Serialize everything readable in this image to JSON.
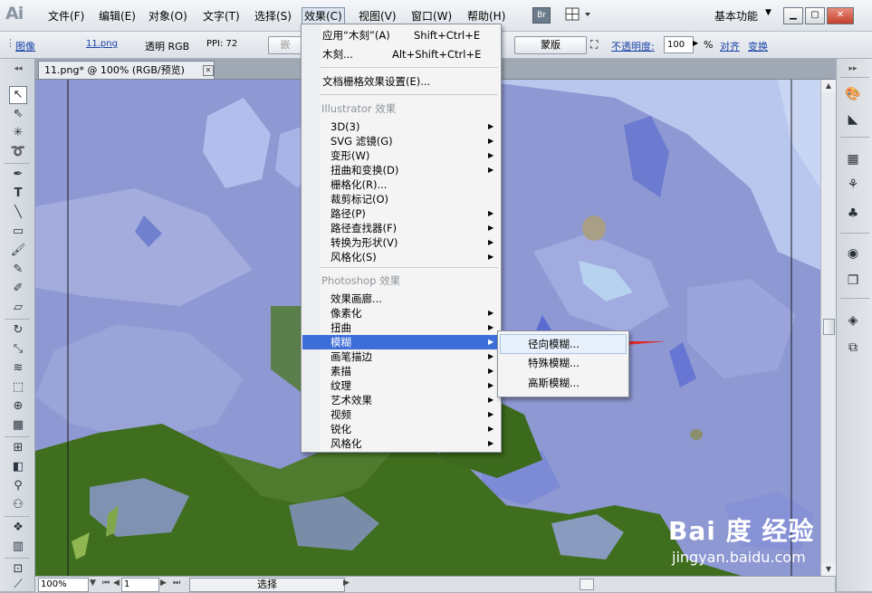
{
  "app": {
    "logo": "Ai"
  },
  "menubar": {
    "items": [
      "文件(F)",
      "编辑(E)",
      "对象(O)",
      "文字(T)",
      "选择(S)",
      "效果(C)",
      "视图(V)",
      "窗口(W)",
      "帮助(H)"
    ],
    "bridge_label": "Br",
    "workspace": "基本功能"
  },
  "controlbar": {
    "object_type": "图像",
    "file_link": "11.png",
    "color_mode": "透明 RGB",
    "ppi": "PPI: 72",
    "embed_button": "嵌",
    "mask_button": "蒙版",
    "opacity_label": "不透明度:",
    "opacity_value": "100",
    "opacity_unit": "%",
    "align_link": "对齐",
    "transform_link": "变换"
  },
  "document": {
    "tab_title": "11.png* @ 100% (RGB/预览)",
    "close_glyph": "✕"
  },
  "effect_menu": {
    "top_items": [
      {
        "label": "应用“木刻”(A)",
        "shortcut": "Shift+Ctrl+E"
      },
      {
        "label": "木刻...",
        "shortcut": "Alt+Shift+Ctrl+E"
      }
    ],
    "raster_settings": "文档栅格效果设置(E)...",
    "illustrator_header": "Illustrator 效果",
    "illustrator_items": [
      "3D(3)",
      "SVG 滤镜(G)",
      "变形(W)",
      "扭曲和变换(D)",
      "栅格化(R)...",
      "裁剪标记(O)",
      "路径(P)",
      "路径查找器(F)",
      "转换为形状(V)",
      "风格化(S)"
    ],
    "photoshop_header": "Photoshop 效果",
    "photoshop_items": [
      "效果画廊...",
      "像素化",
      "扭曲",
      "模糊",
      "画笔描边",
      "素描",
      "纹理",
      "艺术效果",
      "视频",
      "锐化",
      "风格化"
    ]
  },
  "blur_submenu": {
    "items": [
      "径向模糊...",
      "特殊模糊...",
      "高斯模糊..."
    ]
  },
  "statusbar": {
    "zoom": "100%",
    "artboard": "1",
    "status": "选择"
  },
  "watermark": {
    "logo": "Bai 度 经验",
    "url": "jingyan.baidu.com"
  },
  "colors": {
    "menu_highlight": "#3d6ed8",
    "canvas_blue": "#8e98d3",
    "canvas_green": "#3e6e1e",
    "annotation_arrow": "#e02a2a"
  }
}
